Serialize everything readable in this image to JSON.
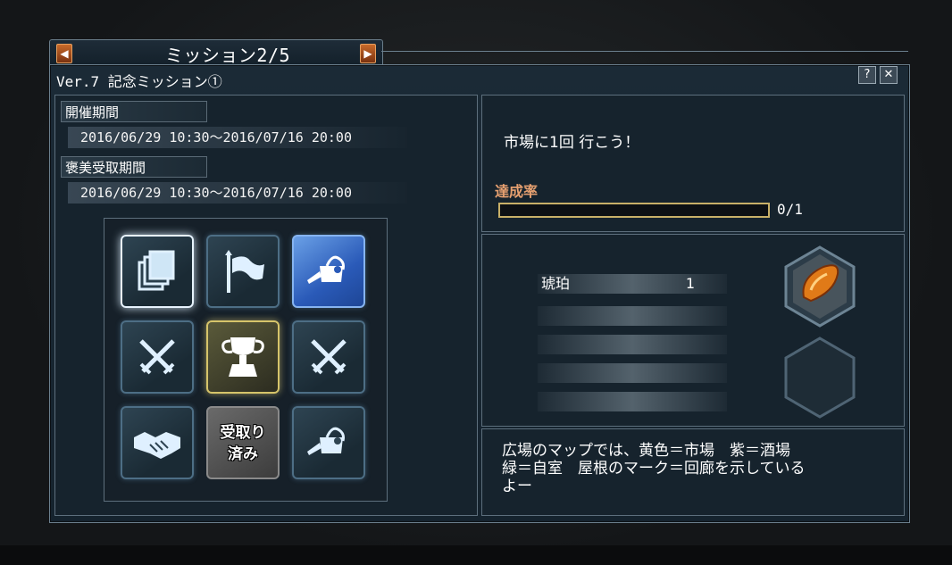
{
  "window": {
    "title": "ミッション2/5",
    "subtitle": "Ver.7 記念ミッション①",
    "prev_icon": "◀",
    "next_icon": "▶",
    "help_label": "?",
    "close_label": "✕"
  },
  "period": {
    "event_label": "開催期間",
    "event_range": "2016/06/29 10:30〜2016/07/16 20:00",
    "reward_label": "褒美受取期間",
    "reward_range": "2016/06/29 10:30〜2016/07/16 20:00"
  },
  "missions": [
    {
      "icon": "cards-icon",
      "state": "selected"
    },
    {
      "icon": "flag-icon",
      "state": "normal"
    },
    {
      "icon": "watering-can-icon",
      "state": "highlight"
    },
    {
      "icon": "crossed-swords-icon",
      "state": "normal"
    },
    {
      "icon": "trophy-icon",
      "state": "gold"
    },
    {
      "icon": "crossed-swords-icon",
      "state": "normal"
    },
    {
      "icon": "handshake-icon",
      "state": "normal"
    },
    {
      "icon": "claimed-badge",
      "state": "claimed",
      "label_line1": "受取り",
      "label_line2": "済み"
    },
    {
      "icon": "watering-can-icon",
      "state": "normal"
    }
  ],
  "detail": {
    "objective": "市場に1回 行こう！",
    "progress_label": "達成率",
    "progress_text": "0/1",
    "progress_fraction": 0
  },
  "rewards": {
    "items": [
      {
        "name": "琥珀",
        "qty": "1",
        "icon": "amber-icon"
      },
      {
        "name": "",
        "qty": ""
      },
      {
        "name": "",
        "qty": ""
      },
      {
        "name": "",
        "qty": ""
      },
      {
        "name": "",
        "qty": ""
      }
    ]
  },
  "hint": {
    "line1": "広場のマップでは、黄色＝市場　紫＝酒場",
    "line2": "緑＝自室　屋根のマーク＝回廊を示している",
    "line3": "よー"
  },
  "colors": {
    "accent_gold": "#c8b068",
    "progress_label": "#e6a070",
    "highlight_blue": "#2a5ab8"
  }
}
